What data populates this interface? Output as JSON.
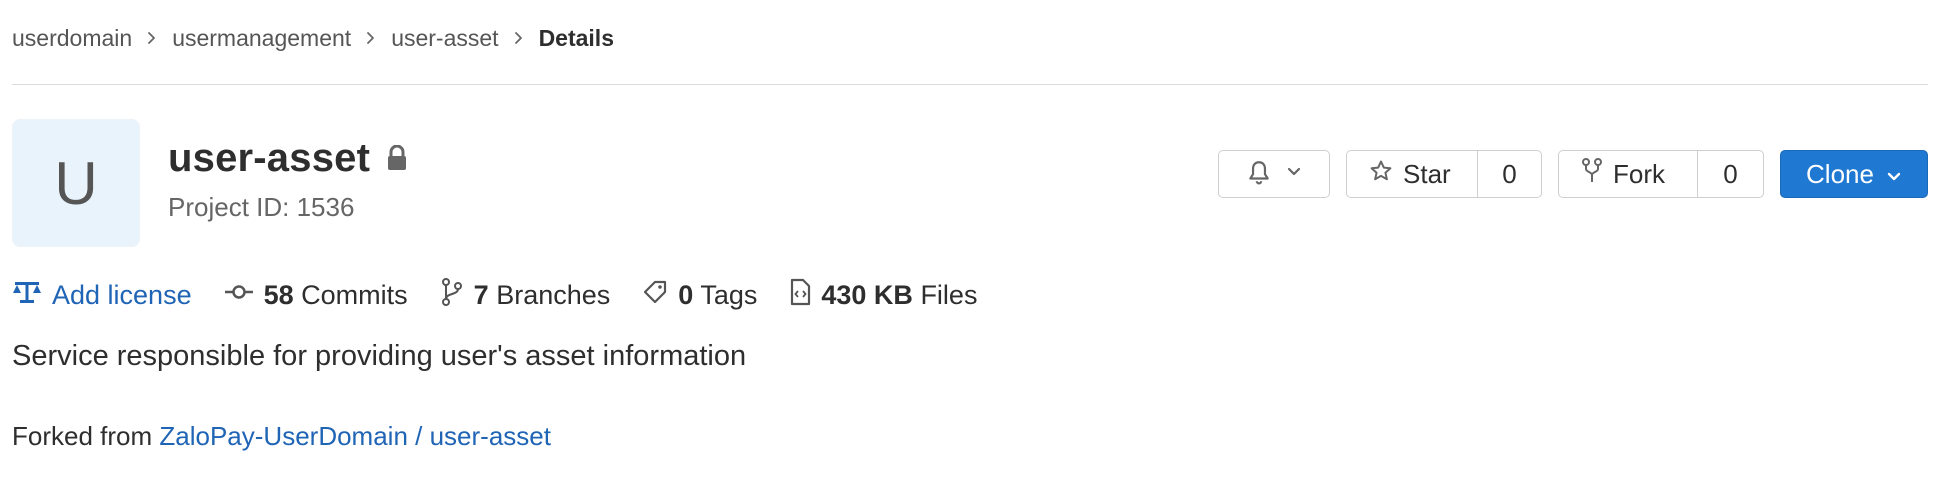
{
  "breadcrumb": {
    "items": [
      {
        "label": "userdomain"
      },
      {
        "label": "usermanagement"
      },
      {
        "label": "user-asset"
      }
    ],
    "current": "Details"
  },
  "project": {
    "avatar_letter": "U",
    "name": "user-asset",
    "visibility_icon": "lock-icon",
    "id_text": "Project ID: 1536",
    "description": "Service responsible for providing user's asset information"
  },
  "actions": {
    "notifications_icon": "bell-icon",
    "star": {
      "label": "Star",
      "count": "0"
    },
    "fork": {
      "label": "Fork",
      "count": "0"
    },
    "clone": {
      "label": "Clone"
    }
  },
  "stats": {
    "license": {
      "label": "Add license"
    },
    "commits": {
      "count": "58",
      "label": "Commits"
    },
    "branches": {
      "count": "7",
      "label": "Branches"
    },
    "tags": {
      "count": "0",
      "label": "Tags"
    },
    "files": {
      "size": "430 KB",
      "label": "Files"
    }
  },
  "forked_from": {
    "prefix": "Forked from",
    "link_text": "ZaloPay-UserDomain / user-asset"
  },
  "colors": {
    "primary": "#1f78d1",
    "link": "#1f64b5",
    "avatar_bg": "#e8f3fc",
    "text": "#2e2e2e",
    "muted": "#666666"
  }
}
